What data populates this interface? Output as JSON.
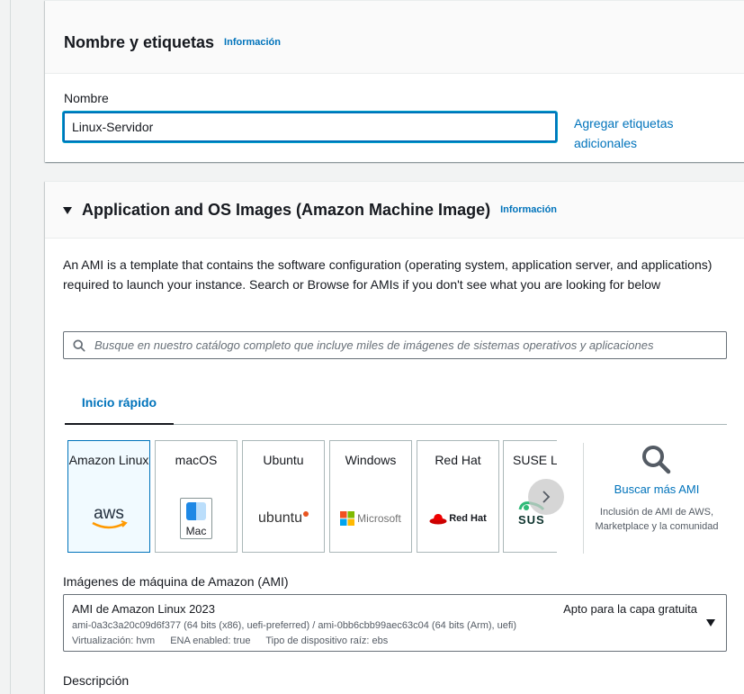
{
  "name_section": {
    "title": "Nombre y etiquetas",
    "info_link": "Información",
    "name_label": "Nombre",
    "name_value": "Linux-Servidor",
    "add_tags_link": "Agregar etiquetas adicionales"
  },
  "ami_section": {
    "title": "Application and OS Images (Amazon Machine Image)",
    "info_link": "Información",
    "description": "An AMI is a template that contains the software configuration (operating system, application server, and applications) required to launch your instance. Search or Browse for AMIs if you don't see what you are looking for below",
    "search_placeholder": "Busque en nuestro catálogo completo que incluye miles de imágenes de sistemas operativos y aplicaciones",
    "tab_quickstart": "Inicio rápido",
    "os_tiles": [
      {
        "label": "Amazon Linux",
        "logo": "aws",
        "selected": true
      },
      {
        "label": "macOS",
        "logo": "Mac",
        "selected": false
      },
      {
        "label": "Ubuntu",
        "logo": "ubuntu",
        "selected": false
      },
      {
        "label": "Windows",
        "logo": "Microsoft",
        "selected": false
      },
      {
        "label": "Red Hat",
        "logo": "Red Hat",
        "selected": false
      },
      {
        "label": "SUSE Li",
        "logo": "SUS",
        "selected": false
      }
    ],
    "browse_more": "Buscar más AMI",
    "browse_sub": "Inclusión de AMI de AWS, Marketplace y la comunidad",
    "ami_label": "Imágenes de máquina de Amazon (AMI)",
    "ami_selected": {
      "name": "AMI de Amazon Linux 2023",
      "tag": "Apto para la capa gratuita",
      "ids": "ami-0a3c3a20c09d6f377 (64 bits (x86), uefi-preferred) / ami-0bb6cbb99aec63c04 (64 bits (Arm), uefi)",
      "virtualization": "Virtualización: hvm",
      "ena": "ENA enabled: true",
      "root_device": "Tipo de dispositivo raíz: ebs"
    },
    "description_label": "Descripción"
  },
  "colors": {
    "link": "#0073bb",
    "text": "#16191f",
    "selected_tile_bg": "#f1faff",
    "page_bg": "#f2f3f3"
  }
}
